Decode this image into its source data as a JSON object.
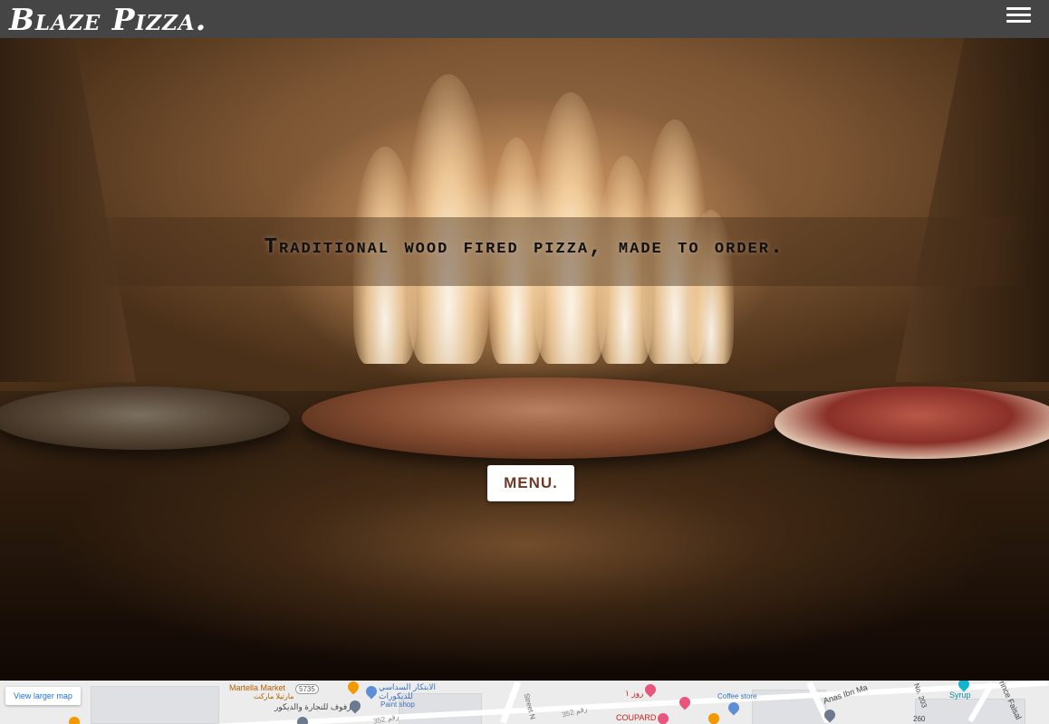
{
  "header": {
    "logo_text": "Blaze Pizza.",
    "menu_icon": "hamburger-menu-icon"
  },
  "hero": {
    "tagline": "Traditional wood fired pizza, made to order.",
    "menu_button_label": "MENU."
  },
  "map": {
    "view_larger_label": "View larger map",
    "labels": {
      "martella_market": "Martella Market",
      "martella_market_ar": "مارتيلا ماركت",
      "road_5735": "5735",
      "alebtikar": "الابتكار السداسي",
      "alebtikar_line2": "للديكورات",
      "paint_shop": "Paint shop",
      "rufouf": "رفوف للنجارة والديكور",
      "raqm_352": "رقم 352",
      "raqm_352b": "352 رقم",
      "street_n": "Street N",
      "rose": "روز ١",
      "coupard": "COUPARD",
      "coffee_store": "Coffee store",
      "anas_ibn_ma": "Anas Ibn Ma",
      "no_203": "No. 203",
      "syrup": "Syrup",
      "prince_faisal": "Prince Faisal",
      "n_260": "260"
    },
    "colors": {
      "poi_orange": "#f29900",
      "poi_blue": "#5e8fd6",
      "poi_pink": "#e8557d",
      "poi_teal": "#12b5cb",
      "text_orange": "#b06000",
      "text_blue": "#3a6fbf",
      "text_pink": "#c5221f"
    }
  }
}
